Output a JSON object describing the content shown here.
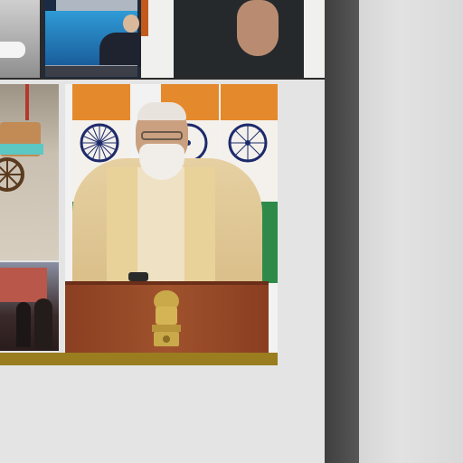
{
  "colors": {
    "canvas_background": "#e4e4e4",
    "divider_band": "#474747",
    "right_panel": "#dcdcdc",
    "gold_bar": "#9a7d1f",
    "flag_saffron": "#e58a2c",
    "flag_green": "#2f8a49",
    "podium": "#a0522d"
  },
  "thumbnails": {
    "top": [
      {
        "name": "street-scene-thumbnail"
      },
      {
        "name": "news-anchor-thumbnail"
      },
      {
        "name": "speaker-gesture-thumbnail"
      }
    ],
    "left": [
      {
        "name": "vendor-cart-thumbnail"
      },
      {
        "name": "market-crowd-thumbnail"
      }
    ]
  },
  "icons": {
    "flag_wheel": "ashoka-chakra-icon",
    "emblem": "national-emblem-icon"
  }
}
